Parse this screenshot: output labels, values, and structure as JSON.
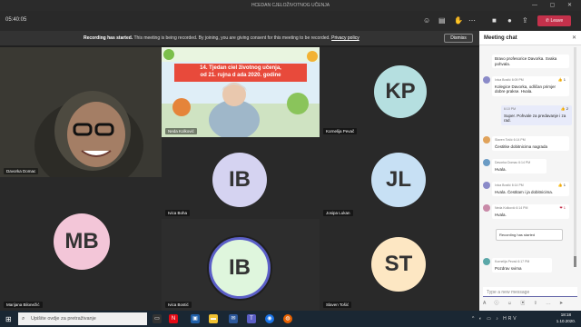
{
  "window": {
    "title": "HCEDAN CJELOŽIVOTNOG UČENJA",
    "controls": "— ▢ ✕"
  },
  "toolbar": {
    "timer": "05:40:05",
    "leave_label": "Leave"
  },
  "banner": {
    "bold": "Recording has started.",
    "text": "This meeting is being recorded. By joining, you are giving consent for this meeting to be recorded.",
    "link": "Privacy policy",
    "dismiss": "Dismiss"
  },
  "tiles": [
    {
      "initials": "",
      "name": "Davorka Domac"
    },
    {
      "initials": "",
      "name": "Neda Kolković"
    },
    {
      "initials": "KP",
      "name": "Kornelija Pevač",
      "bg": "#b5dfe0"
    },
    {
      "initials": "IB",
      "name": "Ivica Boha",
      "bg": "#d5d3f1"
    },
    {
      "initials": "JL",
      "name": "Josipa Lukan",
      "bg": "#c7e0f4"
    },
    {
      "initials": "MB",
      "name": "Marijana Bilonežić",
      "bg": "#f3c6d8"
    },
    {
      "initials": "IB",
      "name": "Ivica Bostić",
      "bg": "#dff6dd"
    },
    {
      "initials": "ST",
      "name": "Slaven Tošić",
      "bg": "#fde7c3"
    }
  ],
  "slide": {
    "line1": "14. Tjedan ciel  životnog učenja,",
    "line2": "od 21. rujna d   ada 2020. godine"
  },
  "chat": {
    "title": "Meeting chat",
    "messages": [
      {
        "text": "Bravo profesorice Davorka. Svaka pohvala.",
        "sender": "",
        "time": ""
      },
      {
        "sender": "Ivica Bostić",
        "time": "6:09 PM",
        "text": "Kolegice Davorka, odličan primjer dobre prakse. Hvala.",
        "react": "👍 1"
      },
      {
        "sender": "",
        "time": "6:10 PM",
        "text": "Super. Pohvale za predavanje i za rad.",
        "react": "👍 2"
      },
      {
        "sender": "Slaven Tošić",
        "time": "6:14 PM",
        "text": "Čestitke dobitnicima nagrada"
      },
      {
        "sender": "Davorka Domac",
        "time": "6:14 PM",
        "text": "Hvala."
      },
      {
        "sender": "Ivica Bostić",
        "time": "6:14 PM",
        "text": "Hvala. Čestitam i ja dobitnicima.",
        "react": "👍 1"
      },
      {
        "sender": "Neda Kolković",
        "time": "6:14 PM",
        "text": "Hvala.",
        "react": "❤ 1"
      },
      {
        "sender": "Kornelija Pevač",
        "time": "6:17 PM",
        "text": "Pozdrav svima"
      }
    ],
    "system": "Recording has started",
    "compose_placeholder": "Type a new message",
    "compose_tools": "A ⓘ ☺ ▣ ⇪ ⋯ ➤"
  },
  "taskbar": {
    "search_placeholder": "Upišite ovdje za pretraživanje",
    "time": "18:18",
    "date": "1.10.2020.",
    "tray": "^ ◐ ▭ ♪ HRV"
  }
}
